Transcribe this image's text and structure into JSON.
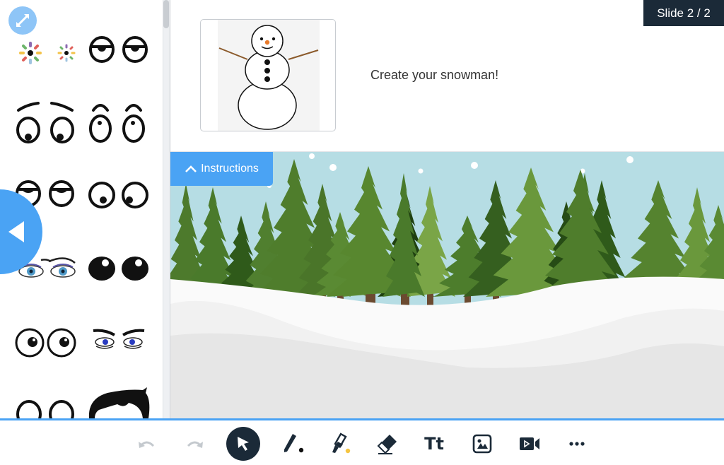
{
  "slide": {
    "indicator": "Slide 2 / 2",
    "current": 2,
    "total": 2,
    "prompt": "Create your snowman!"
  },
  "instructions": {
    "label": "Instructions",
    "icon": "chevron-up-icon"
  },
  "sidebar": {
    "expand_icon": "expand-arrows-icon",
    "collapse_icon": "triangle-left-icon",
    "stickers": [
      {
        "name": "rainbow-eye-large",
        "row": 1
      },
      {
        "name": "rainbow-eye-small",
        "row": 1
      },
      {
        "name": "sleepy-eyes",
        "row": 1
      },
      {
        "name": "sad-eyes-with-brows",
        "row": 2
      },
      {
        "name": "surprised-eyes-with-brows",
        "row": 2
      },
      {
        "name": "half-closed-eyes",
        "row": 3
      },
      {
        "name": "side-glance-eyes",
        "row": 3
      },
      {
        "name": "blue-lashed-eyes",
        "row": 4
      },
      {
        "name": "shiny-black-eyes",
        "row": 4
      },
      {
        "name": "googly-eyes",
        "row": 5
      },
      {
        "name": "angry-blue-eyes",
        "row": 5
      },
      {
        "name": "bottom-half-eyes",
        "row": 6
      },
      {
        "name": "black-hair",
        "row": 6
      }
    ]
  },
  "thumbnail": {
    "description": "snowman-image"
  },
  "toolbar": {
    "tools": [
      {
        "name": "undo",
        "icon": "undo-icon",
        "enabled": false
      },
      {
        "name": "redo",
        "icon": "redo-icon",
        "enabled": false
      },
      {
        "name": "select",
        "icon": "cursor-icon",
        "active": true
      },
      {
        "name": "pen",
        "icon": "pen-icon",
        "color": "#111111"
      },
      {
        "name": "highlighter",
        "icon": "highlighter-icon",
        "color": "#f5c542"
      },
      {
        "name": "eraser",
        "icon": "eraser-icon"
      },
      {
        "name": "text",
        "label": "Tt"
      },
      {
        "name": "image",
        "icon": "image-icon"
      },
      {
        "name": "video",
        "icon": "video-icon"
      },
      {
        "name": "more",
        "icon": "more-dots-icon"
      }
    ]
  },
  "colors": {
    "accent": "#4aa3f4",
    "dark": "#1b2a38",
    "sky": "#b6dde4"
  }
}
